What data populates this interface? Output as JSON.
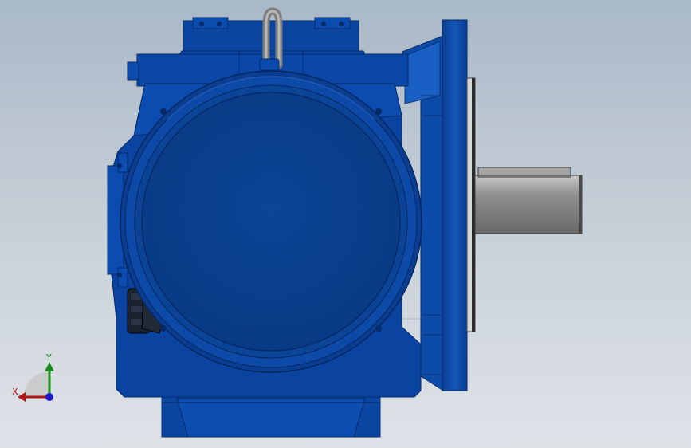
{
  "viewport": {
    "background_top": "#a9b8c8",
    "background_bottom": "#dfe3e8",
    "model_color": "#0b45a0",
    "shaft_color": "#8c8c8c"
  },
  "triad": {
    "x_label": "X",
    "y_label": "Y",
    "x_color": "#b01818",
    "y_color": "#1a8a1a",
    "z_color": "#1a1acc"
  }
}
